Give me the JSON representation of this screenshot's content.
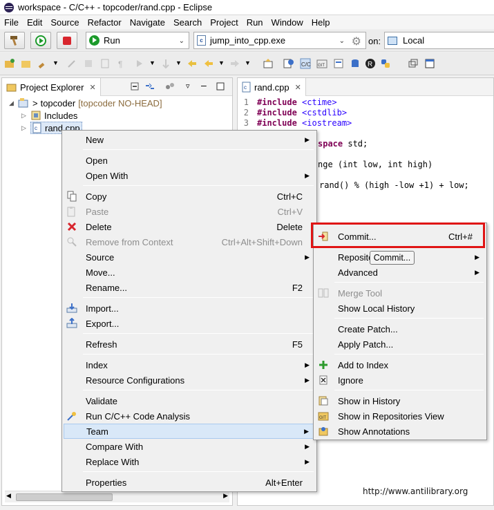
{
  "window": {
    "title": "workspace - C/C++ - topcoder/rand.cpp - Eclipse"
  },
  "menubar": [
    "File",
    "Edit",
    "Source",
    "Refactor",
    "Navigate",
    "Search",
    "Project",
    "Run",
    "Window",
    "Help"
  ],
  "toolbar": {
    "run_config": "Run",
    "launch_target": "jump_into_cpp.exe",
    "on_label": "on:",
    "connection": "Local"
  },
  "explorer": {
    "tab_title": "Project Explorer",
    "project_prefix": ">",
    "project_name": "topcoder",
    "project_decoration": "[topcoder NO-HEAD]",
    "items": [
      "Includes",
      "rand.cpp"
    ]
  },
  "editor": {
    "tab_title": "rand.cpp",
    "lines": [
      {
        "num": "1",
        "kw": "#include",
        "rest": " <ctime>"
      },
      {
        "num": "2",
        "kw": "#include",
        "rest": " <cstdlib>"
      },
      {
        "num": "3",
        "kw": "#include",
        "rest": " <iostream>"
      }
    ],
    "fragments": {
      "namespace_kw": "space",
      "namespace_rest": " std;",
      "fn_kw": "nge",
      "fn_args": " (int low, int high)",
      "ret_expr": "rand() % (high -low +1) + low;"
    }
  },
  "context_menu": {
    "items": [
      {
        "label": "New",
        "submenu": true
      },
      {
        "label": "Open"
      },
      {
        "label": "Open With",
        "submenu": true
      },
      {
        "label": "Copy",
        "accel": "Ctrl+C",
        "icon": "copy-icon"
      },
      {
        "label": "Paste",
        "accel": "Ctrl+V",
        "disabled": true,
        "icon": "paste-icon"
      },
      {
        "label": "Delete",
        "accel": "Delete",
        "icon": "delete-icon"
      },
      {
        "label": "Remove from Context",
        "accel": "Ctrl+Alt+Shift+Down",
        "disabled": true,
        "icon": "remove-context-icon"
      },
      {
        "label": "Source",
        "submenu": true
      },
      {
        "label": "Move..."
      },
      {
        "label": "Rename...",
        "accel": "F2"
      },
      {
        "label": "Import...",
        "icon": "import-icon"
      },
      {
        "label": "Export...",
        "icon": "export-icon"
      },
      {
        "label": "Refresh",
        "accel": "F5"
      },
      {
        "label": "Index",
        "submenu": true
      },
      {
        "label": "Resource Configurations",
        "submenu": true
      },
      {
        "label": "Validate"
      },
      {
        "label": "Run C/C++ Code Analysis",
        "icon": "code-analysis-icon"
      },
      {
        "label": "Team",
        "submenu": true,
        "highlighted": true
      },
      {
        "label": "Compare With",
        "submenu": true
      },
      {
        "label": "Replace With",
        "submenu": true
      },
      {
        "label": "Properties",
        "accel": "Alt+Enter"
      }
    ]
  },
  "team_menu": {
    "items": [
      {
        "label": "Commit...",
        "accel": "Ctrl+#"
      },
      {
        "label": "Reposito",
        "submenu": true
      },
      {
        "label": "Advanced",
        "submenu": true
      },
      {
        "label": "Merge Tool",
        "disabled": true
      },
      {
        "label": "Show Local History"
      },
      {
        "label": "Create Patch..."
      },
      {
        "label": "Apply Patch..."
      },
      {
        "label": "Add to Index"
      },
      {
        "label": "Ignore"
      },
      {
        "label": "Show in History"
      },
      {
        "label": "Show in Repositories View"
      },
      {
        "label": "Show Annotations"
      }
    ]
  },
  "tooltip": {
    "text": "Commit..."
  },
  "watermark": "http://www.antilibrary.org",
  "colors": {
    "highlight_box": "#e01414",
    "keyword": "#7f0055",
    "include_path": "#2a00ff",
    "decoration": "#8b6b3d"
  }
}
